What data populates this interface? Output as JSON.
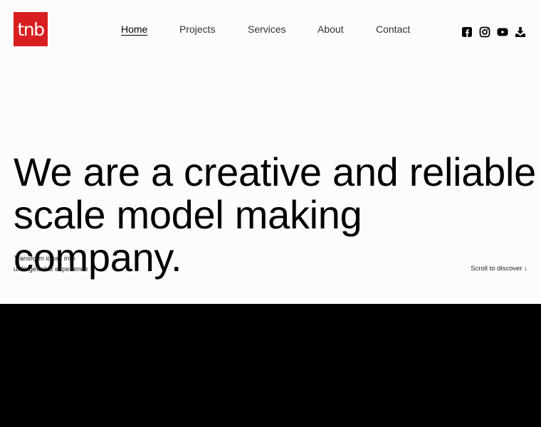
{
  "brand": {
    "logo_text": "tnb",
    "logo_color": "#d81e1e"
  },
  "nav": {
    "items": [
      {
        "label": "Home",
        "active": true
      },
      {
        "label": "Projects",
        "active": false
      },
      {
        "label": "Services",
        "active": false
      },
      {
        "label": "About",
        "active": false
      },
      {
        "label": "Contact",
        "active": false
      }
    ]
  },
  "social": {
    "icons": [
      "facebook-icon",
      "instagram-icon",
      "youtube-icon",
      "download-icon"
    ]
  },
  "hero": {
    "headline": "We are a creative and reliable scale model making company.",
    "tagline_line1": "Transform ideas into",
    "tagline_line2": "unforgettable experience",
    "scroll_label": "Scroll to discover ↓"
  },
  "colors": {
    "background": "#fcfcfc",
    "text": "#000000",
    "dark_section": "#000000"
  }
}
